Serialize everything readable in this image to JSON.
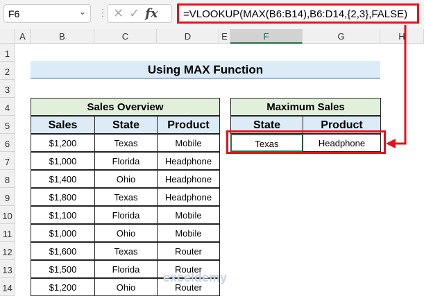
{
  "formula_bar": {
    "name_box": "F6",
    "cancel_icon": "✕",
    "enter_icon": "✓",
    "fx_label": "fx",
    "formula": "=VLOOKUP(MAX(B6:B14),B6:D14,{2,3},FALSE)"
  },
  "columns": [
    "A",
    "B",
    "C",
    "D",
    "E",
    "F",
    "G",
    "H"
  ],
  "rows": [
    "1",
    "2",
    "3",
    "4",
    "5",
    "6",
    "7",
    "8",
    "9",
    "10",
    "11",
    "12",
    "13",
    "14"
  ],
  "title": "Using MAX Function",
  "sales_table": {
    "title": "Sales Overview",
    "headers": [
      "Sales",
      "State",
      "Product"
    ],
    "rows": [
      [
        "$1,200",
        "Texas",
        "Mobile"
      ],
      [
        "$1,000",
        "Florida",
        "Headphone"
      ],
      [
        "$1,400",
        "Ohio",
        "Headphone"
      ],
      [
        "$1,800",
        "Texas",
        "Headphone"
      ],
      [
        "$1,100",
        "Florida",
        "Mobile"
      ],
      [
        "$1,000",
        "Ohio",
        "Mobile"
      ],
      [
        "$1,600",
        "Texas",
        "Router"
      ],
      [
        "$1,500",
        "Florida",
        "Router"
      ],
      [
        "$1,200",
        "Ohio",
        "Router"
      ]
    ]
  },
  "max_table": {
    "title": "Maximum Sales",
    "headers": [
      "State",
      "Product"
    ],
    "values": [
      "Texas",
      "Headphone"
    ]
  },
  "watermark": "exceldemy",
  "colors": {
    "highlight": "#e8101a",
    "header_fill": "#ddebf7",
    "title_fill": "#e2efda",
    "selection": "#217346"
  }
}
